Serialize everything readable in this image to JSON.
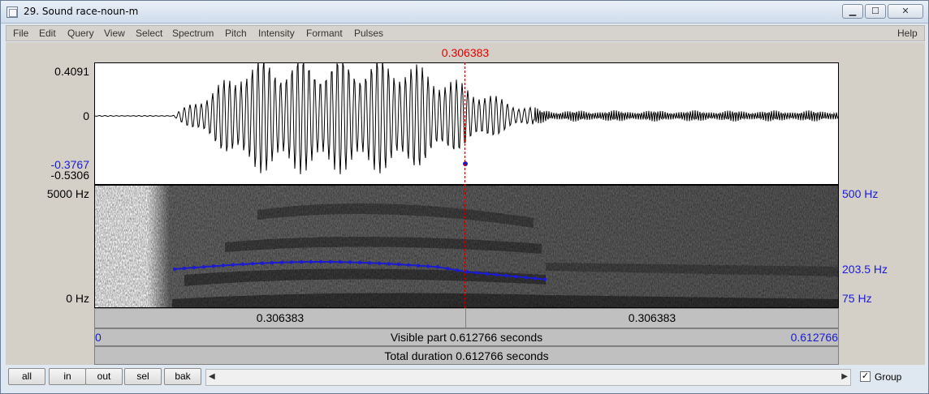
{
  "window": {
    "title": "29. Sound race-noun-m"
  },
  "menu": {
    "items": [
      "File",
      "Edit",
      "Query",
      "View",
      "Select",
      "Spectrum",
      "Pitch",
      "Intensity",
      "Formant",
      "Pulses"
    ],
    "help": "Help"
  },
  "waveform": {
    "cursor_time": "0.306383",
    "y_max": "0.4091",
    "y_zero": "0",
    "y_cursor_value": "-0.3767",
    "y_min": "-0.5306"
  },
  "spectrogram": {
    "freq_max": "5000 Hz",
    "freq_min": "0 Hz",
    "pitch_top": "500 Hz",
    "pitch_cursor": "203.5 Hz",
    "pitch_bottom": "75 Hz"
  },
  "timebar": {
    "left_segment": "0.306383",
    "right_segment": "0.306383",
    "visible_start": "0",
    "visible_label": "Visible part 0.612766 seconds",
    "visible_end": "0.612766",
    "total_label": "Total duration 0.612766 seconds"
  },
  "buttons": {
    "all": "all",
    "in": "in",
    "out": "out",
    "sel": "sel",
    "bak": "bak"
  },
  "group": {
    "label": "Group",
    "checked": true
  },
  "colors": {
    "cursor": "#e00000",
    "pitch": "#1b1bd0",
    "axis_blue": "#1b1bd0"
  }
}
